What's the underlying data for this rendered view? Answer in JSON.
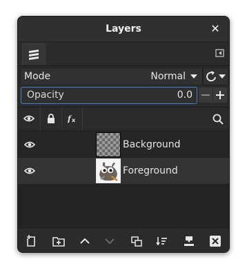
{
  "window": {
    "title": "Layers",
    "close_icon": "close-icon"
  },
  "tabs": [
    {
      "icon": "layers-stack-icon",
      "active": true
    }
  ],
  "tab_menu_icon": "tab-menu-icon",
  "mode": {
    "label": "Mode",
    "value": "Normal",
    "reset_icon": "reset-mode-icon"
  },
  "opacity": {
    "label": "Opacity",
    "value": "0.0",
    "fraction": 0,
    "decrement_icon": "minus-icon",
    "increment_icon": "plus-icon"
  },
  "list_header": {
    "columns": [
      "visibility-header-icon",
      "lock-header-icon",
      "effects-header-icon",
      "search-icon"
    ]
  },
  "layers": [
    {
      "name": "Background",
      "thumbnail": "transparent-checkerboard",
      "visible": true,
      "selected": false
    },
    {
      "name": "Foreground",
      "thumbnail": "wilber-mascot",
      "visible": true,
      "selected": true
    }
  ],
  "footer": {
    "buttons": [
      "new-layer-icon",
      "new-layer-group-icon",
      "raise-layer-icon",
      "lower-layer-icon",
      "duplicate-layer-icon",
      "merge-down-icon",
      "anchor-layer-icon",
      "delete-layer-icon"
    ]
  },
  "colors": {
    "panel_bg": "#2b2b2b",
    "selected_row": "#343434",
    "focus_border": "#3d7fd3",
    "text": "#e6e6e6"
  }
}
